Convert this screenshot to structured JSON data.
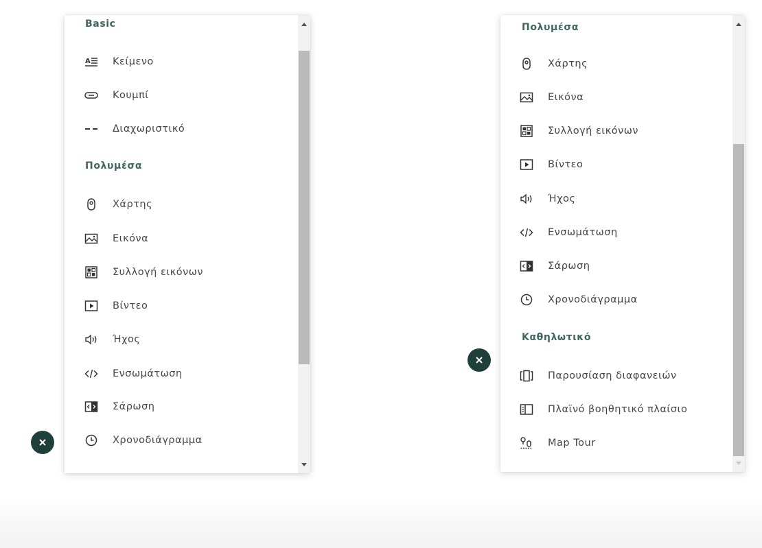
{
  "left_panel": {
    "sections": {
      "basic": {
        "heading": "Basic",
        "items": [
          "Κείμενο",
          "Κουμπί",
          "Διαχωριστικό"
        ]
      },
      "multimedia": {
        "heading": "Πολυμέσα",
        "items": [
          "Χάρτης",
          "Εικόνα",
          "Συλλογή εικόνων",
          "Βίντεο",
          "Ήχος",
          "Ενσωμάτωση",
          "Σάρωση",
          "Χρονοδιάγραμμα"
        ]
      }
    },
    "scrollbar": {
      "position_fraction": 0.02,
      "visible_fraction": 0.7
    }
  },
  "right_panel": {
    "sections": {
      "multimedia": {
        "heading": "Πολυμέσα",
        "items": [
          "Χάρτης",
          "Εικόνα",
          "Συλλογή εικόνων",
          "Βίντεο",
          "Ήχος",
          "Ενσωμάτωση",
          "Σάρωση",
          "Χρονοδιάγραμμα"
        ]
      },
      "immersive": {
        "heading": "Καθηλωτικό",
        "items": [
          "Παρουσίαση διαφανειών",
          "Πλαϊνό βοηθητικό πλαίσιο",
          "Map Tour"
        ]
      }
    },
    "scrollbar": {
      "position_fraction": 1.0,
      "visible_fraction": 0.7
    }
  },
  "icons": {
    "text": "text-icon",
    "button": "button-icon",
    "separator": "separator-icon",
    "map": "map-pin-icon",
    "image": "image-icon",
    "gallery": "gallery-icon",
    "video": "video-icon",
    "audio": "audio-icon",
    "embed": "embed-icon",
    "swipe": "swipe-icon",
    "timeline": "timeline-icon",
    "slideshow": "slideshow-icon",
    "sidecar": "sidecar-icon",
    "map_tour": "map-tour-icon",
    "close": "close-icon"
  },
  "colors": {
    "heading": "#3f6760",
    "item_text": "#454545",
    "icon": "#333333",
    "close_badge": "#1e3f3a",
    "scroll_track": "#f1f1f1",
    "scroll_thumb": "#b9b9b9"
  }
}
